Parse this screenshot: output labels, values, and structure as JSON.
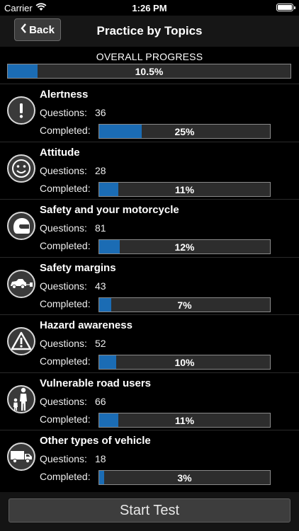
{
  "status": {
    "carrier": "Carrier",
    "time": "1:26 PM"
  },
  "nav": {
    "back_label": "Back",
    "title": "Practice by Topics"
  },
  "overall": {
    "label": "OVERALL PROGRESS",
    "percent_text": "10.5%",
    "fraction": 0.105
  },
  "labels": {
    "questions": "Questions:",
    "completed": "Completed:"
  },
  "topics": [
    {
      "title": "Alertness",
      "questions": "36",
      "completed_text": "25%",
      "fraction": 0.25,
      "icon": "exclamation-icon"
    },
    {
      "title": "Attitude",
      "questions": "28",
      "completed_text": "11%",
      "fraction": 0.11,
      "icon": "smiley-icon"
    },
    {
      "title": "Safety and your motorcycle",
      "questions": "81",
      "completed_text": "12%",
      "fraction": 0.12,
      "icon": "helmet-icon"
    },
    {
      "title": "Safety margins",
      "questions": "43",
      "completed_text": "7%",
      "fraction": 0.07,
      "icon": "car-tow-icon"
    },
    {
      "title": "Hazard awareness",
      "questions": "52",
      "completed_text": "10%",
      "fraction": 0.1,
      "icon": "warning-triangle-icon"
    },
    {
      "title": "Vulnerable road users",
      "questions": "66",
      "completed_text": "11%",
      "fraction": 0.11,
      "icon": "pedestrians-icon"
    },
    {
      "title": "Other types of vehicle",
      "questions": "18",
      "completed_text": "3%",
      "fraction": 0.03,
      "icon": "truck-icon"
    }
  ],
  "start_button": {
    "label": "Start Test"
  },
  "colors": {
    "progress_fill": "#1b6cb4",
    "progress_track": "#2d2d2d"
  }
}
